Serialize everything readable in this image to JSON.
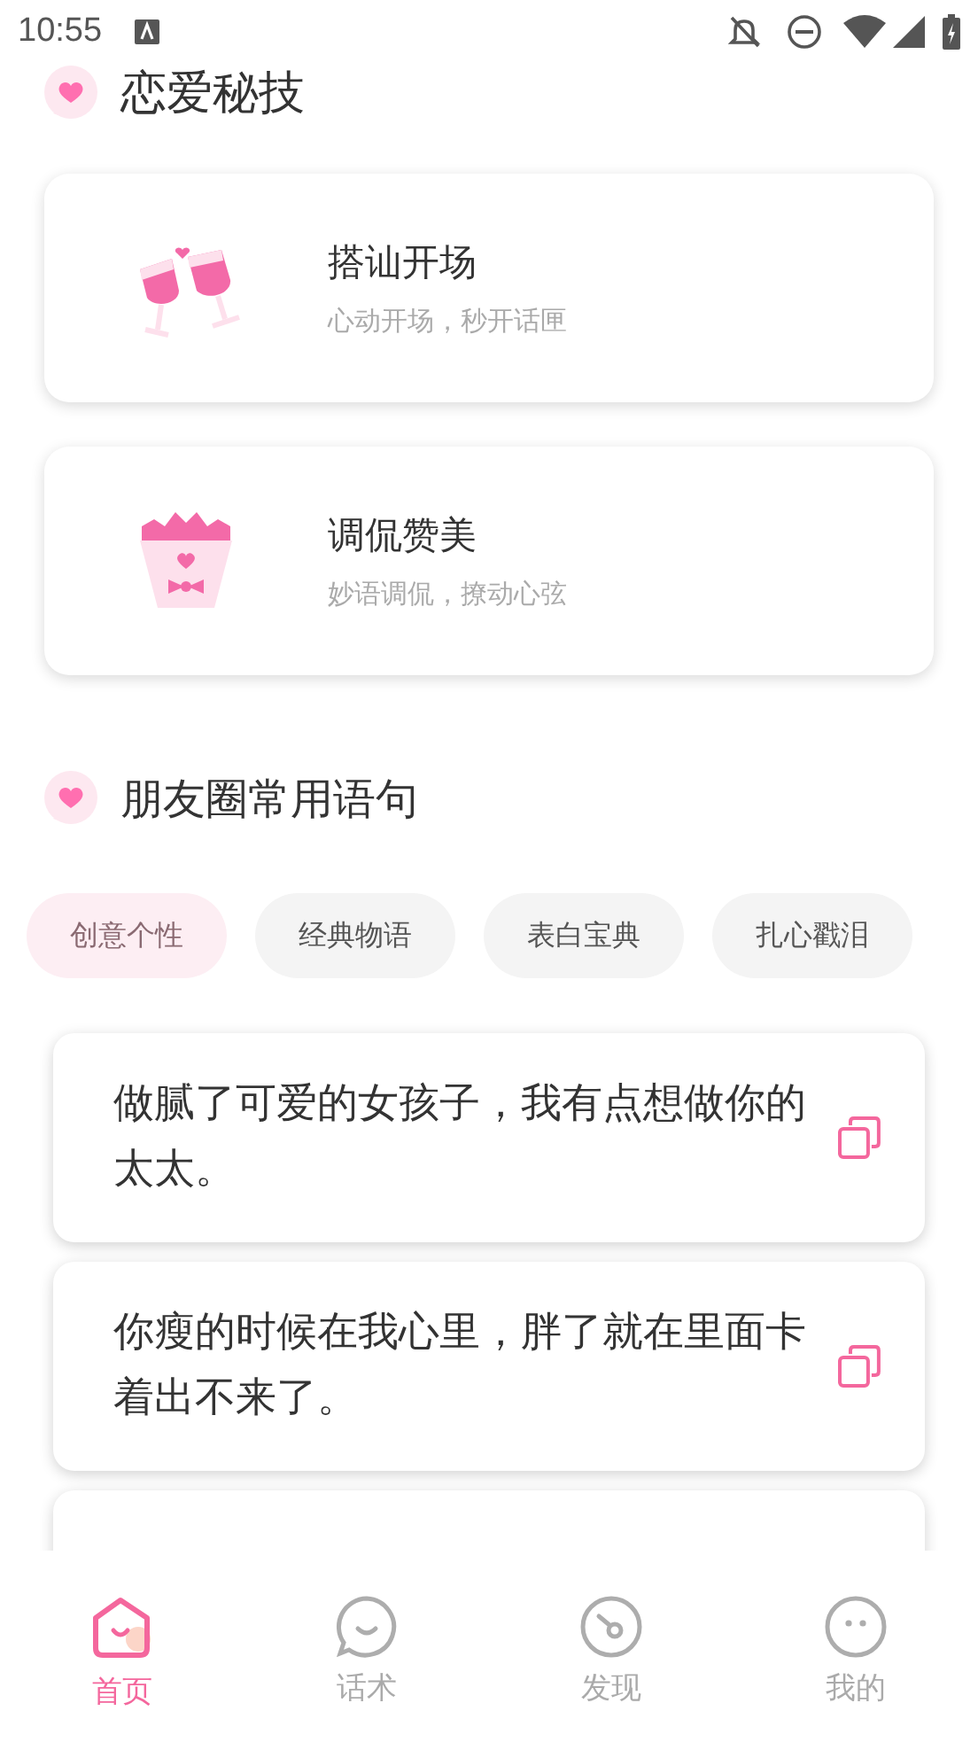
{
  "status_bar": {
    "time": "10:55"
  },
  "tips_section": {
    "title": "恋爱秘技",
    "cards": [
      {
        "kind": "glasses",
        "title": "搭讪开场",
        "subtitle": "心动开场，秒开话匣"
      },
      {
        "kind": "bouquet",
        "title": "调侃赞美",
        "subtitle": "妙语调侃，撩动心弦"
      }
    ]
  },
  "phrases_section": {
    "title": "朋友圈常用语句",
    "tabs": [
      {
        "label": "创意个性",
        "selected": true
      },
      {
        "label": "经典物语",
        "selected": false
      },
      {
        "label": "表白宝典",
        "selected": false
      },
      {
        "label": "扎心戳泪",
        "selected": false
      }
    ],
    "quotes": [
      {
        "kind": "full",
        "text": "做腻了可爱的女孩子，我有点想做你的太太。"
      },
      {
        "kind": "full",
        "text": "你瘦的时候在我心里，胖了就在里面卡着出不来了。"
      },
      {
        "kind": "covered"
      }
    ]
  },
  "bottom_nav": [
    {
      "kind": "home",
      "label": "首页",
      "selected": true
    },
    {
      "kind": "chat",
      "label": "话术",
      "selected": false
    },
    {
      "kind": "discover",
      "label": "发现",
      "selected": false
    },
    {
      "kind": "me",
      "label": "我的",
      "selected": false
    }
  ]
}
